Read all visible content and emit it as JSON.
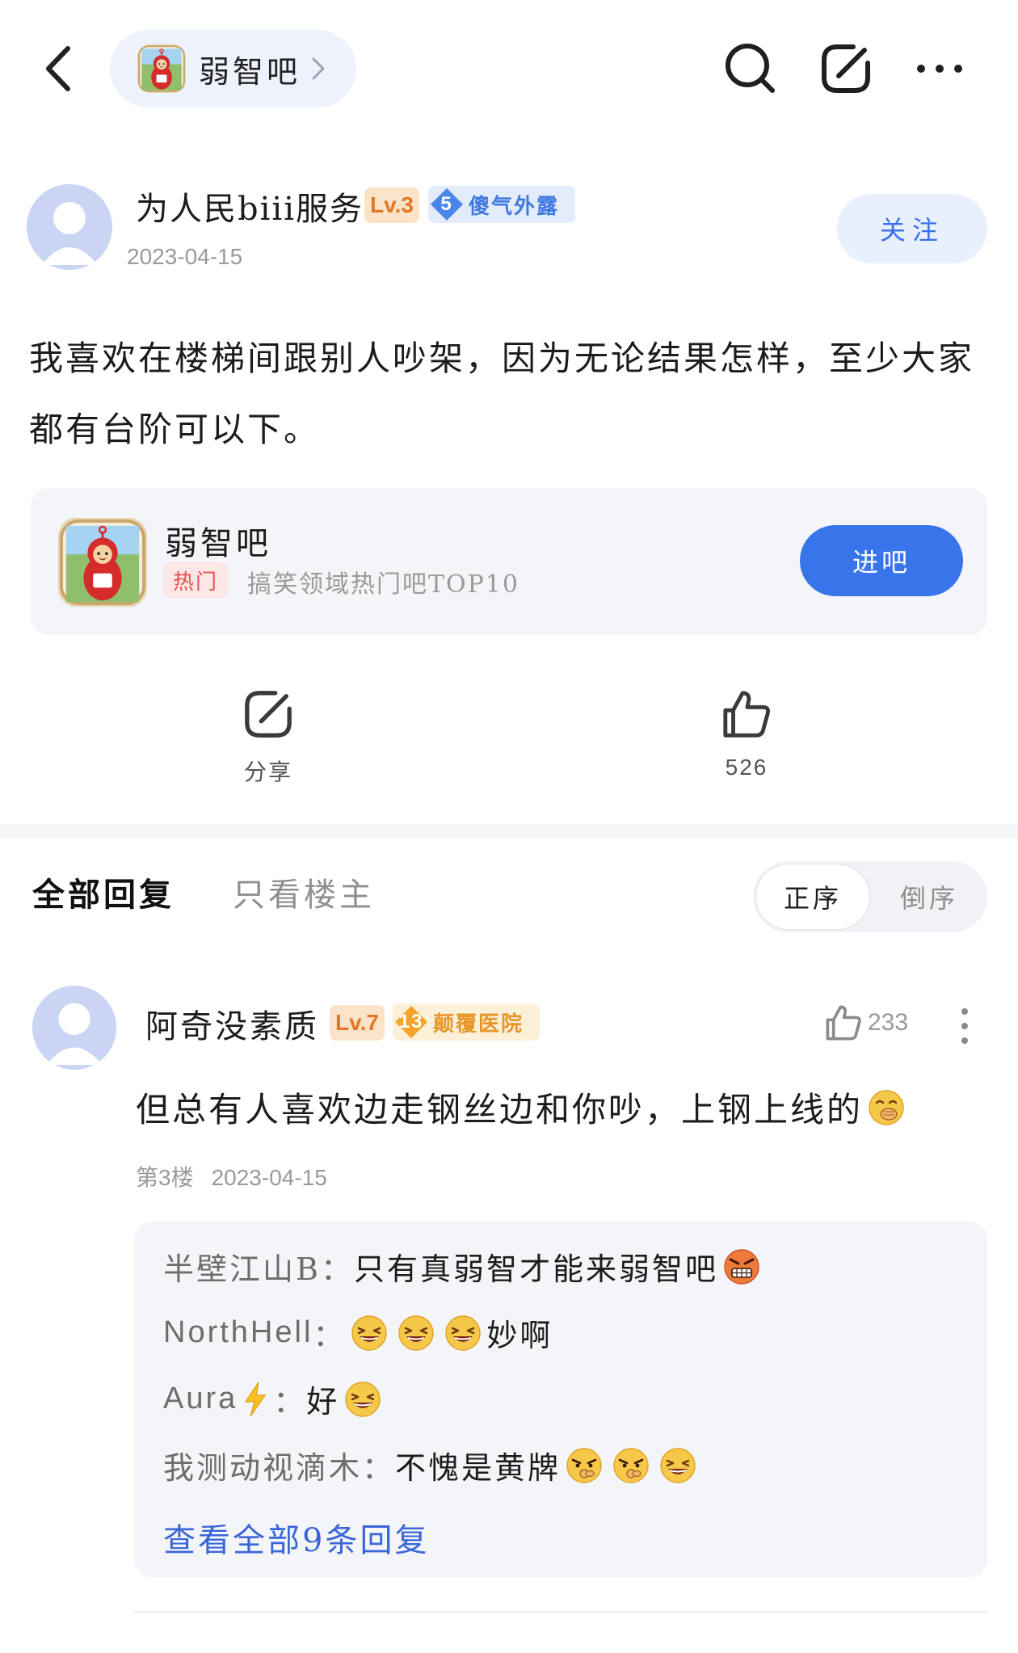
{
  "header": {
    "forum_name": "弱智吧"
  },
  "post": {
    "author": {
      "name": "为人民biii服务",
      "level": "Lv.3",
      "title_level": "5",
      "title": "傻气外露"
    },
    "date": "2023-04-15",
    "follow_label": "关注",
    "content": "我喜欢在楼梯间跟别人吵架，因为无论结果怎样，至少大家都有台阶可以下。"
  },
  "forum_card": {
    "name": "弱智吧",
    "hot_badge": "热门",
    "description": "搞笑领域热门吧TOP10",
    "enter_label": "进吧"
  },
  "actions": {
    "share_label": "分享",
    "like_count": "526"
  },
  "replies_header": {
    "tab_all": "全部回复",
    "tab_op_only": "只看楼主",
    "sort_asc": "正序",
    "sort_desc": "倒序"
  },
  "comment": {
    "author": {
      "name": "阿奇没素质",
      "level": "Lv.7",
      "title_level": "13",
      "title": "颠覆医院"
    },
    "like_count": "233",
    "text": "但总有人喜欢边走钢丝边和你吵，上钢上线的",
    "floor": "第3楼",
    "date": "2023-04-15",
    "sub_replies": [
      {
        "user": "半壁江山B",
        "sep": "：",
        "text": "只有真弱智才能来弱智吧"
      },
      {
        "user": "NorthHell",
        "sep": "：",
        "text": "妙啊"
      },
      {
        "user": "Aura",
        "sep": "：",
        "text": "好"
      },
      {
        "user": "我测动视滴木",
        "sep": "：",
        "text": "不愧是黄牌"
      }
    ],
    "view_all_label": "查看全部9条回复"
  },
  "colors": {
    "accent": "#3874ea",
    "link": "#3a66d8",
    "level_badge_bg": "#fbe3c8",
    "level_badge_text": "#e07826",
    "hot_badge_bg": "#fde6e6",
    "hot_badge_text": "#e95050"
  }
}
